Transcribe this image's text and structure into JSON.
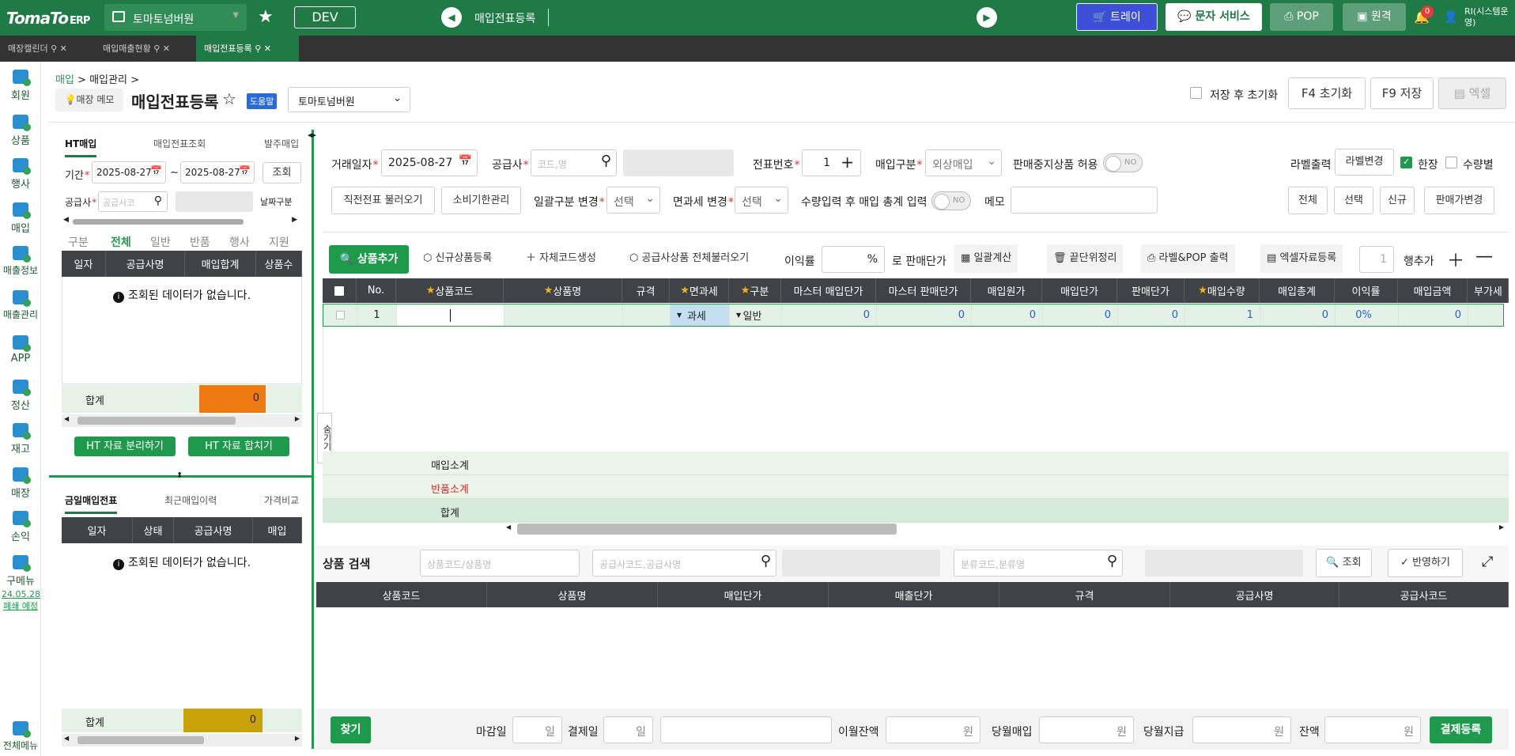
{
  "header": {
    "logo": "TomaTo",
    "logo_suffix": "ERP",
    "store": "토마토넘버원",
    "env": "DEV",
    "page_title": "매입전표등록",
    "buttons": {
      "tray": "트레이",
      "sms": "문자 서비스",
      "pop": "POP",
      "remote": "원격"
    },
    "notif_count": "0",
    "user": "RI(시스템운영)"
  },
  "tabs": [
    {
      "label": "매장캘린더"
    },
    {
      "label": "매입매출현황"
    },
    {
      "label": "매입전표등록"
    }
  ],
  "sidenav": [
    {
      "label": "회원"
    },
    {
      "label": "상품"
    },
    {
      "label": "행사"
    },
    {
      "label": "매입"
    },
    {
      "label": "매출정보"
    },
    {
      "label": "매출관리"
    },
    {
      "label": "APP"
    },
    {
      "label": "정산"
    },
    {
      "label": "재고"
    },
    {
      "label": "매장"
    },
    {
      "label": "손익"
    },
    {
      "label": "구메뉴"
    },
    {
      "label": "전체메뉴"
    }
  ],
  "sidenav_note": {
    "line1": "24.05.28",
    "line2": "폐쇄 예정"
  },
  "breadcrumb": {
    "a": "매입",
    "b": "매입관리"
  },
  "page": {
    "memo_btn": "매장 메모",
    "title": "매입전표등록",
    "help": "도움말",
    "store_select": "토마토넘버원",
    "reset_after_save": "저장 후 초기화",
    "f4": "F4 초기화",
    "f9": "F9 저장",
    "excel": "엑셀"
  },
  "left": {
    "tabs": [
      "HT매입",
      "매입전표조회",
      "발주매입"
    ],
    "period_label": "기간",
    "date_from": "2025-08-27",
    "tilde": "~",
    "date_to": "2025-08-27",
    "search_btn": "조회",
    "supplier_label": "공급사",
    "supplier_ph": "공급사코",
    "date_type": "날짜구분",
    "filters": [
      "구분",
      "전체",
      "일반",
      "반품",
      "행사",
      "지원"
    ],
    "cols": [
      "일자",
      "공급사명",
      "매입합계",
      "상품수"
    ],
    "empty": "조회된 데이터가 없습니다.",
    "total_label": "합계",
    "total_a": "0",
    "total_b": "0",
    "split_btn": "HT 자료 분리하기",
    "merge_btn": "HT 자료 합치기",
    "tabs2": [
      "금일매입전표",
      "최근매입이력",
      "가격비교"
    ],
    "cols2": [
      "일자",
      "상태",
      "공급사명",
      "매입"
    ],
    "empty2": "조회된 데이터가 없습니다.",
    "total2_label": "합계",
    "total2": "0"
  },
  "form": {
    "trade_date_label": "거래일자",
    "trade_date": "2025-08-27",
    "supplier_label": "공급사",
    "supplier_ph": "코드,명",
    "slip_no_label": "전표번호",
    "slip_no": "1",
    "buy_type_label": "매입구분",
    "buy_type": "외상매입",
    "allow_stop_label": "판매중지상품 허용",
    "toggle_no": "NO",
    "label_print_label": "라벨출력",
    "label_change_btn": "라벨변경",
    "per_sheet": "한장",
    "per_qty": "수량별",
    "prev_slip_btn": "직전전표 불러오기",
    "expiry_btn": "소비기한관리",
    "bulk_type_label": "일괄구분 변경",
    "select": "선택",
    "tax_change_label": "면과세 변경",
    "qty_total_label": "수량입력 후 매입 총계 입력",
    "memo_label": "메모",
    "all_btn": "전체",
    "select_btn": "선택",
    "new_btn": "신규",
    "price_change_btn": "판매가변경"
  },
  "toolbar": {
    "add_product": "상품추가",
    "new_product": "신규상품등록",
    "self_code": "자체코드생성",
    "load_supplier": "공급사상품 전체불러오기",
    "margin_label": "이익률",
    "margin_unit": "%",
    "to_price": "로 판매단가",
    "bulk_calc": "일괄계산",
    "cleanup": "끝단위정리",
    "label_pop": "라벨&POP 출력",
    "excel_reg": "엑셀자료등록",
    "row_count": "1",
    "add_rows": "행추가"
  },
  "grid": {
    "cols": [
      "No.",
      "상품코드",
      "상품명",
      "규격",
      "면과세",
      "구분",
      "마스터 매입단가",
      "마스터 판매단가",
      "매입원가",
      "매입단가",
      "판매단가",
      "매입수량",
      "매입총계",
      "이익률",
      "매입금액",
      "부가세"
    ],
    "row": {
      "no": "1",
      "tax": "과세",
      "kind": "일반",
      "master_buy": "0",
      "master_sell": "0",
      "cost": "0",
      "buy_price": "0",
      "sell_price": "0",
      "qty": "1",
      "total": "0",
      "margin": "0%",
      "amount": "0"
    },
    "sub_buy": "매입소계",
    "sub_return": "반품소계",
    "sum": "합계",
    "hide": "숨기기"
  },
  "search": {
    "title": "상품 검색",
    "product_ph": "상품코드/상품명",
    "supplier_ph": "공급사코드,공급사명",
    "category_ph": "분류코드,분류명",
    "search_btn": "조회",
    "apply_btn": "반영하기",
    "cols": [
      "상품코드",
      "상품명",
      "매입단가",
      "매출단가",
      "규격",
      "공급사명",
      "공급사코드"
    ]
  },
  "footer": {
    "find_btn": "찾기",
    "close_day_label": "마감일",
    "day_unit": "일",
    "pay_day_label": "결제일",
    "carry_label": "이월잔액",
    "won": "원",
    "month_buy_label": "당월매입",
    "month_pay_label": "당월지급",
    "balance_label": "잔액",
    "settle_btn": "결제등록"
  },
  "colors": {
    "brand": "#1f7a45",
    "accent": "#1f9a4d",
    "tray": "#3d4fd6",
    "orange": "#f07a12",
    "mustard": "#c9a20a"
  }
}
